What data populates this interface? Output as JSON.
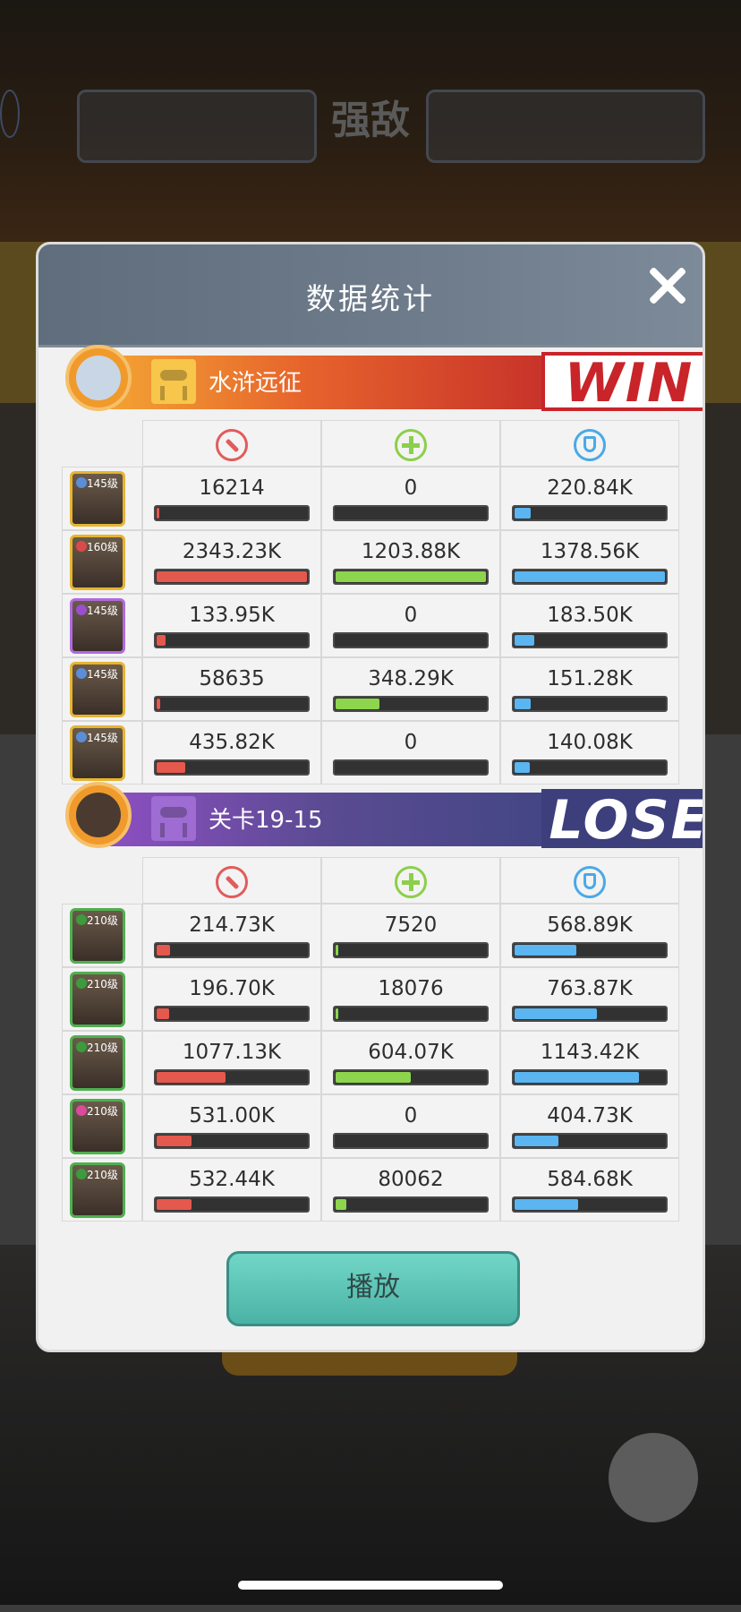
{
  "background": {
    "title_glyph": "强敌"
  },
  "modal": {
    "title": "数据统计"
  },
  "teams": [
    {
      "name": "水浒远征",
      "result": "WIN",
      "heroes": [
        {
          "level": "145级",
          "damage": "16214",
          "heal": "0",
          "defense": "220.84K",
          "damage_frac": 0.007,
          "heal_frac": 0.0,
          "defense_frac": 0.11
        },
        {
          "level": "160级",
          "damage": "2343.23K",
          "heal": "1203.88K",
          "defense": "1378.56K",
          "damage_frac": 1.0,
          "heal_frac": 1.0,
          "defense_frac": 1.0
        },
        {
          "level": "145级",
          "damage": "133.95K",
          "heal": "0",
          "defense": "183.50K",
          "damage_frac": 0.06,
          "heal_frac": 0.0,
          "defense_frac": 0.13
        },
        {
          "level": "145级",
          "damage": "58635",
          "heal": "348.29K",
          "defense": "151.28K",
          "damage_frac": 0.025,
          "heal_frac": 0.29,
          "defense_frac": 0.11
        },
        {
          "level": "145级",
          "damage": "435.82K",
          "heal": "0",
          "defense": "140.08K",
          "damage_frac": 0.19,
          "heal_frac": 0.0,
          "defense_frac": 0.1
        }
      ]
    },
    {
      "name": "关卡19-15",
      "result": "LOSE",
      "heroes": [
        {
          "level": "210级",
          "damage": "214.73K",
          "heal": "7520",
          "defense": "568.89K",
          "damage_frac": 0.09,
          "heal_frac": 0.01,
          "defense_frac": 0.41
        },
        {
          "level": "210级",
          "damage": "196.70K",
          "heal": "18076",
          "defense": "763.87K",
          "damage_frac": 0.085,
          "heal_frac": 0.02,
          "defense_frac": 0.55
        },
        {
          "level": "210级",
          "damage": "1077.13K",
          "heal": "604.07K",
          "defense": "1143.42K",
          "damage_frac": 0.46,
          "heal_frac": 0.5,
          "defense_frac": 0.83
        },
        {
          "level": "210级",
          "damage": "531.00K",
          "heal": "0",
          "defense": "404.73K",
          "damage_frac": 0.23,
          "heal_frac": 0.0,
          "defense_frac": 0.29
        },
        {
          "level": "210级",
          "damage": "532.44K",
          "heal": "80062",
          "defense": "584.68K",
          "damage_frac": 0.23,
          "heal_frac": 0.07,
          "defense_frac": 0.42
        }
      ]
    }
  ],
  "stat_icons": {
    "damage": "sword-icon",
    "heal": "plus-icon",
    "defense": "shield-icon"
  },
  "colors": {
    "damage": "#e5584d",
    "heal": "#8cd54c",
    "defense": "#5ab5f0",
    "win": "#c8242a",
    "lose": "#3c3f7c",
    "play_button": "#5cc4b5"
  },
  "play_button": {
    "label": "播放"
  }
}
